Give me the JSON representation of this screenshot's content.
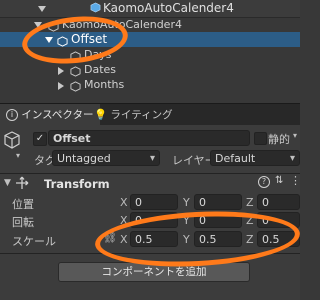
{
  "hierarchy": {
    "root": "KaomoAutoCalender4",
    "items": [
      {
        "label": "KaomoAutoCalender4"
      },
      {
        "label": "Offset"
      },
      {
        "label": "Days"
      },
      {
        "label": "Dates"
      },
      {
        "label": "Months"
      }
    ]
  },
  "tabs": [
    {
      "label": "インスペクター"
    },
    {
      "label": "ライティング"
    }
  ],
  "object": {
    "name": "Offset",
    "static_label": "静的",
    "tag_label": "タグ",
    "tag_value": "Untagged",
    "layer_label": "レイヤー",
    "layer_value": "Default"
  },
  "transform": {
    "title": "Transform",
    "position_label": "位置",
    "rotation_label": "回転",
    "scale_label": "スケール",
    "position": {
      "x": "0",
      "y": "0",
      "z": "0"
    },
    "rotation": {
      "x": "0",
      "y": "0",
      "z": "0"
    },
    "scale": {
      "x": "0.5",
      "y": "0.5",
      "z": "0.5"
    }
  },
  "add_component_label": "コンポーネントを追加",
  "colors": {
    "selection": "#2c5d87",
    "highlight_ring": "#ff7a1a",
    "panel": "#3c3c3c"
  }
}
